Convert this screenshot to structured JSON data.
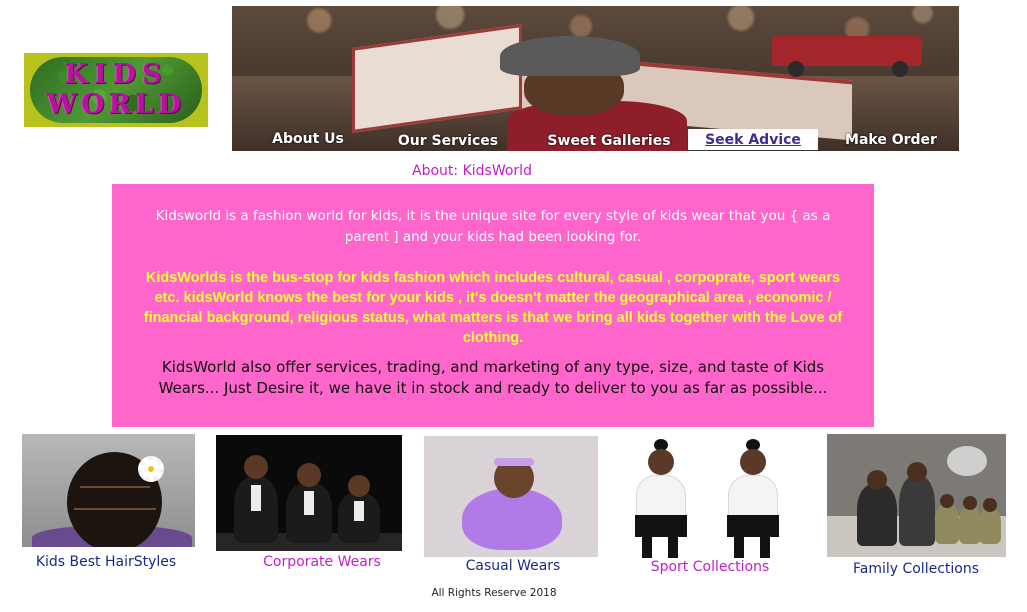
{
  "logo": {
    "line1": "KIDS",
    "line2": "WORLD"
  },
  "banner": {
    "image": "christmas-baby-photo"
  },
  "nav": {
    "items": [
      {
        "label": "About Us"
      },
      {
        "label": "Our Services"
      },
      {
        "label": "Sweet Galleries"
      },
      {
        "label": "Seek Advice",
        "active": true
      },
      {
        "label": "Make Order"
      }
    ]
  },
  "page": {
    "title": "About: KidsWorld"
  },
  "about": {
    "paragraph1": "Kidsworld is a fashion world for kids, it is the unique site for every style of kids wear that you { as a parent ] and your kids had been looking for.",
    "paragraph2": "KidsWorlds is the bus-stop for kids fashion which includes cultural, casual , corpoprate, sport wears etc. kidsWorld knows the best for your kids , it's doesn't matter the geographical area , economic / financial background, religious status, what matters is that we bring all kids together with the Love of clothing.",
    "paragraph3": "KidsWorld also offer services, trading, and marketing of any type, size, and taste of Kids Wears... Just Desire it, we have it in stock and ready to deliver to you as far as possible..."
  },
  "gallery": [
    {
      "caption": "Kids Best HairStyles",
      "image": "girl-hairstyle-photo"
    },
    {
      "caption": "Corporate Wears",
      "image": "boys-tuxedo-photo"
    },
    {
      "caption": "Casual Wears",
      "image": "baby-tutu-photo"
    },
    {
      "caption": "Sport Collections",
      "image": "girls-sport-outfit-photo"
    },
    {
      "caption": "Family Collections",
      "image": "family-photo"
    }
  ],
  "footer": {
    "text": "All Rights Reserve 2018"
  },
  "colors": {
    "pink_box": "#ff66cc",
    "yellow_text": "#ffff33",
    "magenta": "#c21ec9",
    "navy": "#1b2a8a"
  }
}
